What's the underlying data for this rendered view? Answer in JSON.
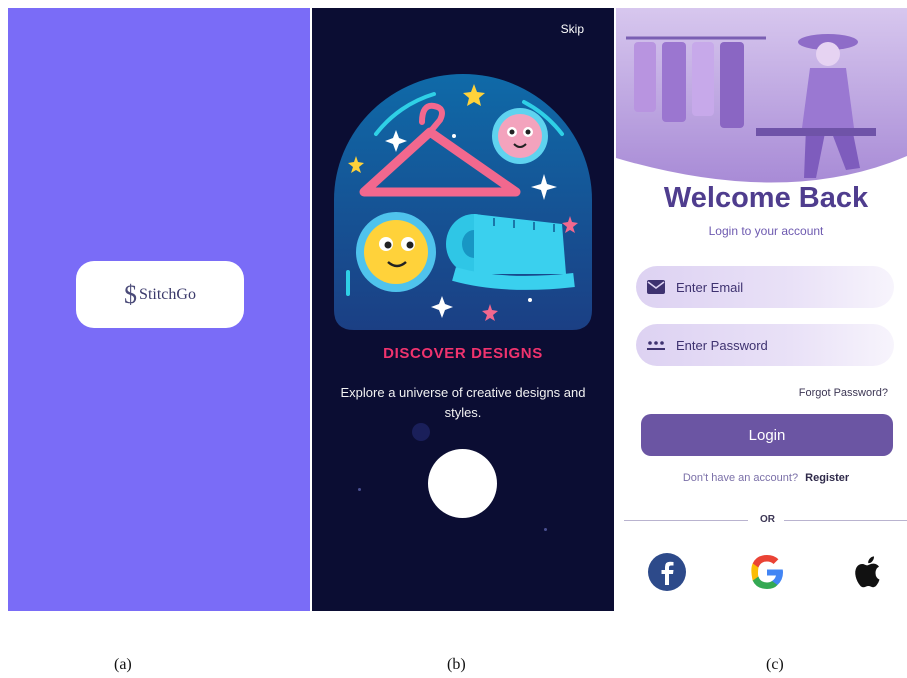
{
  "splash": {
    "brand_name": "StitchGo",
    "brand_mark": "$",
    "background": "#7a6cf7"
  },
  "onboarding": {
    "skip_label": "Skip",
    "title": "DISCOVER DESIGNS",
    "body": "Explore a universe of creative designs and styles.",
    "background": "#0b0d33",
    "accent": "#f0336e",
    "illustration_icons": [
      "hanger-icon",
      "measuring-tape-icon",
      "smiley-face-icon",
      "star-icon"
    ]
  },
  "login": {
    "title": "Welcome Back",
    "subtitle": "Login to your account",
    "email_placeholder": "Enter Email",
    "password_placeholder": "Enter Password",
    "forgot_label": "Forgot Password?",
    "login_label": "Login",
    "no_account_text": "Don't have an account?",
    "register_label": "Register",
    "divider_label": "OR",
    "primary_color": "#6b55a3",
    "social_icons": [
      "facebook-icon",
      "google-icon",
      "apple-icon"
    ]
  },
  "captions": [
    "(a)",
    "(b)",
    "(c)"
  ]
}
